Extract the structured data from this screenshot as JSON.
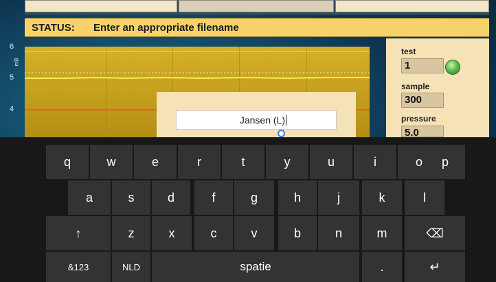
{
  "status": {
    "label": "STATUS:",
    "message": "Enter an appropriate filename"
  },
  "chart": {
    "y_ticks": [
      "6",
      "5",
      "4"
    ],
    "y_unit": "mB"
  },
  "side_panel": {
    "test_label": "test",
    "test_value": "1",
    "sample_label": "sample",
    "sample_value": "300",
    "pressure_label": "pressure",
    "pressure_value": "5.0"
  },
  "filename_dialog": {
    "value": "Jansen (L)"
  },
  "keyboard": {
    "row1": [
      "q",
      "w",
      "e",
      "r",
      "t",
      "y",
      "u",
      "i",
      "o",
      "p"
    ],
    "row2": [
      "a",
      "s",
      "d",
      "f",
      "g",
      "h",
      "j",
      "k",
      "l"
    ],
    "row3": [
      "↑",
      "z",
      "x",
      "c",
      "v",
      "b",
      "n",
      "m",
      "⌫"
    ],
    "row4": [
      "&123",
      "NLD",
      "spatie",
      ".",
      "↵"
    ]
  },
  "colors": {
    "status_bg": "#f5d36a",
    "plot_bg": "#d6b028",
    "key_bg": "#333333",
    "keyboard_bg": "#181818"
  }
}
